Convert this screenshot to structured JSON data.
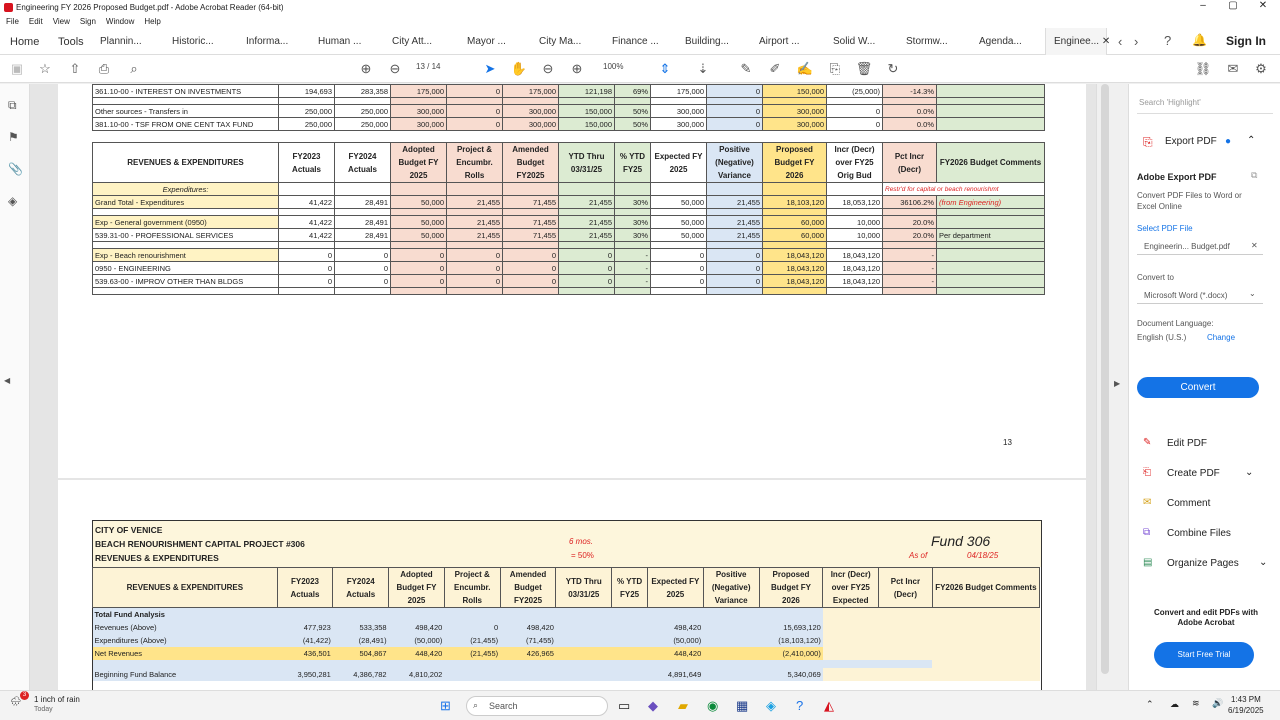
{
  "window": {
    "title": "Engineering FY 2026 Proposed Budget.pdf - Adobe Acrobat Reader (64-bit)"
  },
  "menu": [
    "File",
    "Edit",
    "View",
    "Sign",
    "Window",
    "Help"
  ],
  "tabs": [
    "Home",
    "Tools",
    "Plannin...",
    "Historic...",
    "Informa...",
    "Human ...",
    "City Att...",
    "Mayor ...",
    "City Ma...",
    "Finance ...",
    "Building...",
    "Airport ...",
    "Solid W...",
    "Stormw...",
    "Agenda...",
    "Enginee..."
  ],
  "signin": "Sign In",
  "toolbar": {
    "page_current": "13",
    "page_total": "/ 14",
    "zoom": "100%"
  },
  "page1": {
    "top_rows": [
      [
        "361.10-00 - INTEREST ON INVESTMENTS",
        "194,693",
        "283,358",
        "175,000",
        "0",
        "175,000",
        "121,198",
        "69%",
        "175,000",
        "0",
        "150,000",
        "(25,000)",
        "-14.3%",
        ""
      ],
      [
        "Other sources - Transfers in",
        "250,000",
        "250,000",
        "300,000",
        "0",
        "300,000",
        "150,000",
        "50%",
        "300,000",
        "0",
        "300,000",
        "0",
        "0.0%",
        ""
      ],
      [
        "381.10-00 - TSF FROM ONE CENT TAX FUND",
        "250,000",
        "250,000",
        "300,000",
        "0",
        "300,000",
        "150,000",
        "50%",
        "300,000",
        "0",
        "300,000",
        "0",
        "0.0%",
        ""
      ]
    ],
    "headers": [
      "REVENUES & EXPENDITURES",
      "FY2023 Actuals",
      "FY2024 Actuals",
      "Adopted Budget FY 2025",
      "Project & Encumbr. Rolls",
      "Amended Budget FY2025",
      "YTD Thru 03/31/25",
      "% YTD FY25",
      "Expected FY 2025",
      "Positive (Negative) Variance",
      "Proposed Budget FY 2026",
      "Incr (Decr) over FY25 Orig Bud",
      "Pct Incr (Decr)",
      "FY2026 Budget Comments"
    ],
    "expend_label": "Expenditures:",
    "restd_note": "Restr'd for capital or beach renourishmt",
    "rows": [
      [
        "Grand Total - Expenditures",
        "41,422",
        "28,491",
        "50,000",
        "21,455",
        "71,455",
        "21,455",
        "30%",
        "50,000",
        "21,455",
        "18,103,120",
        "18,053,120",
        "36106.2%",
        "(from Engineering)"
      ],
      [
        "Exp - General government (0950)",
        "41,422",
        "28,491",
        "50,000",
        "21,455",
        "71,455",
        "21,455",
        "30%",
        "50,000",
        "21,455",
        "60,000",
        "10,000",
        "20.0%",
        ""
      ],
      [
        "539.31-00 - PROFESSIONAL SERVICES",
        "41,422",
        "28,491",
        "50,000",
        "21,455",
        "71,455",
        "21,455",
        "30%",
        "50,000",
        "21,455",
        "60,000",
        "10,000",
        "20.0%",
        "Per department"
      ],
      [
        "Exp - Beach renourishment",
        "0",
        "0",
        "0",
        "0",
        "0",
        "0",
        "-",
        "0",
        "0",
        "18,043,120",
        "18,043,120",
        "-",
        ""
      ],
      [
        "0950 - ENGINEERING",
        "0",
        "0",
        "0",
        "0",
        "0",
        "0",
        "-",
        "0",
        "0",
        "18,043,120",
        "18,043,120",
        "-",
        ""
      ],
      [
        "539.63-00 - IMPROV OTHER THAN BLDGS",
        "0",
        "0",
        "0",
        "0",
        "0",
        "0",
        "-",
        "0",
        "0",
        "18,043,120",
        "18,043,120",
        "-",
        ""
      ]
    ],
    "page_number": "13"
  },
  "page2": {
    "city": "CITY OF VENICE",
    "project": "BEACH RENOURISHMENT CAPITAL PROJECT #306",
    "subtitle": "REVENUES & EXPENDITURES",
    "months": "6 mos.",
    "pct": "= 50%",
    "fund": "Fund 306",
    "asof_label": "As of",
    "asof_date": "04/18/25",
    "headers": [
      "REVENUES & EXPENDITURES",
      "FY2023 Actuals",
      "FY2024 Actuals",
      "Adopted Budget FY 2025",
      "Project & Encumbr. Rolls",
      "Amended Budget FY2025",
      "YTD Thru 03/31/25",
      "% YTD FY25",
      "Expected FY 2025",
      "Positive (Negative) Variance",
      "Proposed Budget FY 2026",
      "Incr (Decr) over FY25 Expected",
      "Pct Incr (Decr)",
      "FY2026 Budget Comments"
    ],
    "rows": [
      [
        "Total Fund Analysis",
        "",
        "",
        "",
        "",
        "",
        "",
        "",
        "",
        "",
        ""
      ],
      [
        "Revenues (Above)",
        "477,923",
        "533,358",
        "498,420",
        "0",
        "498,420",
        "",
        "",
        "498,420",
        "",
        "15,693,120"
      ],
      [
        "Expenditures (Above)",
        "(41,422)",
        "(28,491)",
        "(50,000)",
        "(21,455)",
        "(71,455)",
        "",
        "",
        "(50,000)",
        "",
        "(18,103,120)"
      ],
      [
        "Net Revenues",
        "436,501",
        "504,867",
        "448,420",
        "(21,455)",
        "426,965",
        "",
        "",
        "448,420",
        "",
        "(2,410,000)"
      ],
      [
        "Beginning Fund Balance",
        "3,950,281",
        "4,386,782",
        "4,810,202",
        "",
        "",
        "",
        "",
        "4,891,649",
        "",
        "5,340,069"
      ]
    ]
  },
  "right_panel": {
    "search_placeholder": "Search 'Highlight'",
    "export_title": "Export PDF",
    "export_heading": "Adobe Export PDF",
    "export_desc": "Convert PDF Files to Word or Excel Online",
    "select_file": "Select PDF File",
    "file_name": "Engineerin... Budget.pdf",
    "convert_to": "Convert to",
    "format": "Microsoft Word (*.docx)",
    "doc_lang": "Document Language:",
    "lang": "English (U.S.)",
    "change": "Change",
    "convert_btn": "Convert",
    "tools": [
      "Edit PDF",
      "Create PDF",
      "Comment",
      "Combine Files",
      "Organize Pages"
    ],
    "promo": "Convert and edit PDFs with Adobe Acrobat",
    "trial": "Start Free Trial"
  },
  "taskbar": {
    "weather": "1 inch of rain",
    "weather_sub": "Today",
    "search": "Search",
    "time": "1:43 PM",
    "date": "6/19/2025",
    "badge": "3"
  }
}
